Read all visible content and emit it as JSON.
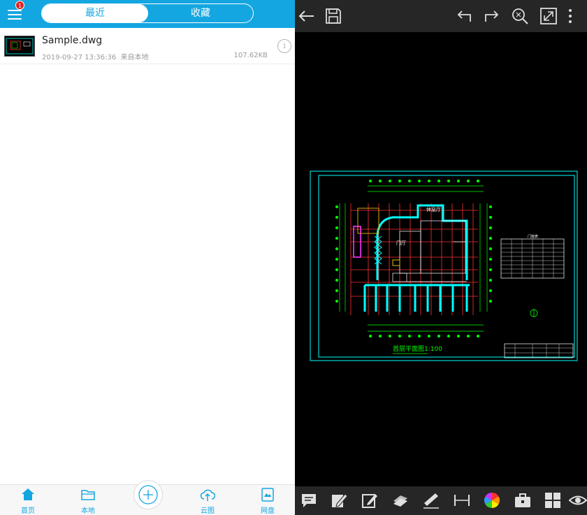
{
  "header": {
    "badge_count": "1",
    "tabs": [
      {
        "label": "最近",
        "active": true
      },
      {
        "label": "收藏",
        "active": false
      }
    ]
  },
  "files": [
    {
      "name": "Sample.dwg",
      "date": "2019-09-27 13:36:36",
      "source": "来自本地",
      "size": "107.62KB",
      "info_icon": "i"
    }
  ],
  "bottom_nav": {
    "items": [
      {
        "label": "首页",
        "icon": "home-icon"
      },
      {
        "label": "本地",
        "icon": "folder-icon"
      },
      {
        "label": "云图",
        "icon": "cloud-upload-icon"
      },
      {
        "label": "网盘",
        "icon": "drive-icon"
      }
    ],
    "add_icon": "plus-icon"
  },
  "viewer": {
    "toolbar_icons": [
      "back-arrow-icon",
      "save-icon",
      "undo-icon",
      "redo-icon",
      "zoom-extents-icon",
      "fullscreen-icon",
      "more-icon"
    ],
    "bottom_tools": [
      "comment-icon",
      "pen-icon",
      "edit-icon",
      "layers-icon",
      "measure-icon",
      "dimension-icon",
      "color-wheel-icon",
      "toolbox-icon",
      "blocks-icon",
      "eye-icon"
    ],
    "drawing": {
      "title": "首层平面图1:100",
      "room_label_1": "休息厅",
      "room_label_2": "门厅",
      "table_title": "门窗表"
    }
  },
  "colors": {
    "accent": "#13a6e1",
    "badge": "#e02424",
    "viewer_bar": "#262626",
    "cad_frame": "#00ffff",
    "cad_red": "#ff3030",
    "cad_green": "#00ff00"
  }
}
